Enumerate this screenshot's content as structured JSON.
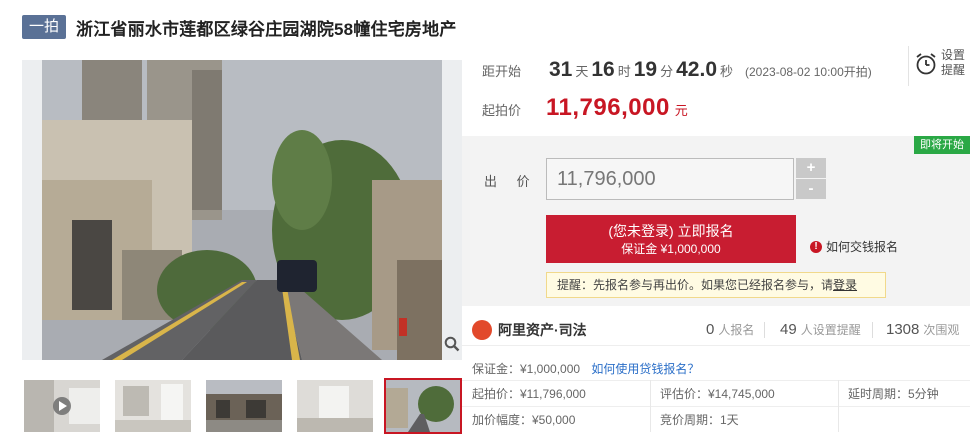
{
  "header": {
    "badge": "一拍",
    "title": "浙江省丽水市莲都区绿谷庄园湖院58幢住宅房地产"
  },
  "countdown": {
    "label": "距开始",
    "days": "31",
    "days_unit": "天",
    "hours": "16",
    "hours_unit": "时",
    "minutes": "19",
    "minutes_unit": "分",
    "seconds": "42.0",
    "seconds_unit": "秒",
    "start_note": "(2023-08-02 10:00开拍)"
  },
  "reminder": {
    "icon": "alarm-clock-icon",
    "label": "设置提醒"
  },
  "start_price": {
    "label": "起拍价",
    "value": "11,796,000",
    "unit": "元"
  },
  "bid": {
    "status_tag": "即将开始",
    "label": "出 价",
    "input_value": "11,796,000",
    "plus": "+",
    "minus": "-",
    "signup_main": "(您未登录) 立即报名",
    "signup_sub": "保证金 ¥1,000,000",
    "how_to_pay": "如何交钱报名",
    "hint_text": "提醒：先报名参与再出价。如果您已经报名参与，请",
    "hint_link": "登录"
  },
  "platform": {
    "name": "阿里资产·司法",
    "signups_num": "0",
    "signups_label": "人报名",
    "reminders_num": "49",
    "reminders_label": "人设置提醒",
    "views_num": "1308",
    "views_label": "次围观"
  },
  "details": {
    "deposit": "保证金：¥1,000,000",
    "deposit_link": "如何使用贷钱报名？",
    "start_price": "起拍价：¥11,796,000",
    "appraisal": "评估价：¥14,745,000",
    "delay": "延时周期：5分钟",
    "increment": "加价幅度：¥50,000",
    "bid_cycle": "竞价周期：1天"
  },
  "colors": {
    "accent": "#c81623",
    "badge": "#5a7196",
    "status_green": "#2aa845",
    "link": "#2b6fc8"
  }
}
